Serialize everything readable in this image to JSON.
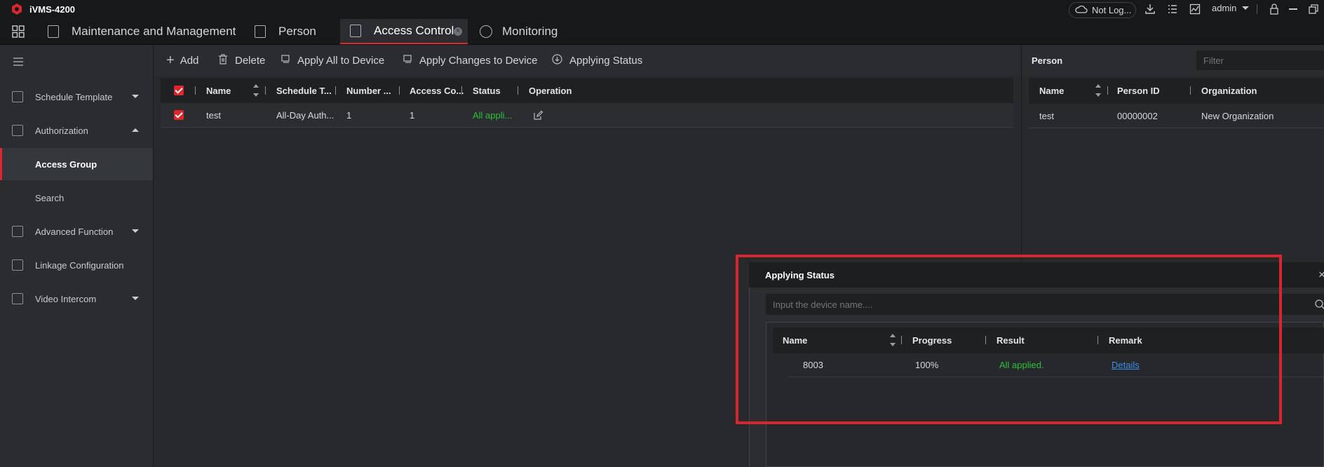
{
  "app": {
    "title": "iVMS-4200",
    "cloud_status": "Not Log...",
    "user": "admin"
  },
  "tabs": [
    {
      "label": "Maintenance and Management"
    },
    {
      "label": "Person"
    },
    {
      "label": "Access Control"
    },
    {
      "label": "Monitoring"
    }
  ],
  "sidebar": {
    "items": [
      {
        "label": "Schedule Template",
        "icon": "schedule-icon",
        "expandable": true,
        "expanded": false
      },
      {
        "label": "Authorization",
        "icon": "lock-icon",
        "expandable": true,
        "expanded": true
      },
      {
        "label": "Access Group",
        "selected": true
      },
      {
        "label": "Search"
      },
      {
        "label": "Advanced Function",
        "icon": "advanced-icon",
        "expandable": true,
        "expanded": false
      },
      {
        "label": "Linkage Configuration",
        "icon": "linkage-icon",
        "expandable": false
      },
      {
        "label": "Video Intercom",
        "icon": "intercom-icon",
        "expandable": true,
        "expanded": false
      }
    ]
  },
  "toolbar": {
    "add": "Add",
    "delete": "Delete",
    "apply_all": "Apply All to Device",
    "apply_changes": "Apply Changes to Device",
    "applying_status": "Applying Status"
  },
  "access_groups": {
    "columns": [
      "Name",
      "Schedule T...",
      "Number ...",
      "Access Co...",
      "Status",
      "Operation"
    ],
    "rows": [
      {
        "name": "test",
        "schedule": "All-Day Auth...",
        "number": "1",
        "access_count": "1",
        "status": "All appli..."
      }
    ]
  },
  "person_pane": {
    "title": "Person",
    "filter_placeholder": "Filter",
    "columns": [
      "Name",
      "Person ID",
      "Organization"
    ],
    "rows": [
      {
        "name": "test",
        "person_id": "00000002",
        "organization": "New Organization"
      }
    ]
  },
  "applying_dialog": {
    "title": "Applying Status",
    "search_placeholder": "Input the device name....",
    "columns": [
      "Name",
      "Progress",
      "Result",
      "Remark"
    ],
    "rows": [
      {
        "name": "8003",
        "progress": "100%",
        "result": "All applied.",
        "remark": "Details"
      }
    ]
  },
  "colors": {
    "accent_red": "#e0262d",
    "success_green": "#2ec03a",
    "link_blue": "#3d8ce6"
  }
}
